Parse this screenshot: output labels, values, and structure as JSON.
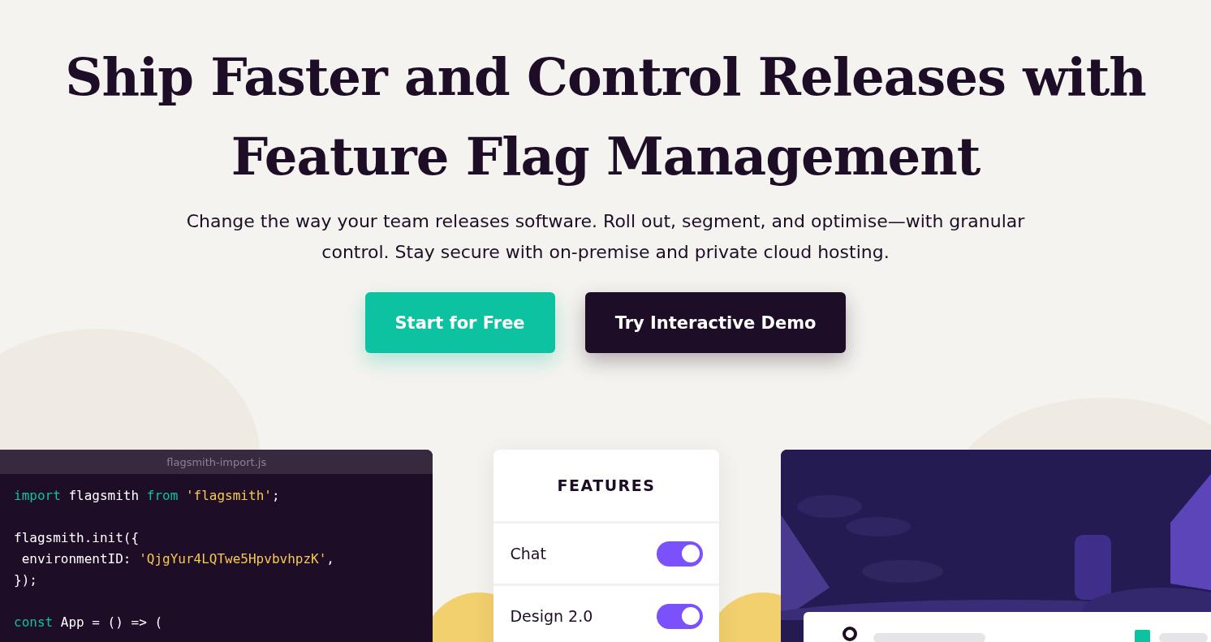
{
  "hero": {
    "title": "Ship Faster and Control Releases with Feature Flag Management",
    "subtitle": "Change the way your team releases software. Roll out, segment, and optimise—with granular control. Stay secure with on-premise and private cloud hosting."
  },
  "buttons": [
    {
      "label": "Start for Free",
      "kind": "primary"
    },
    {
      "label": "Try Interactive Demo",
      "kind": "dark"
    }
  ],
  "code_panel": {
    "filename": "flagsmith-import.js",
    "lines": [
      {
        "kind": "code",
        "tokens": [
          {
            "kind": "keyword",
            "text": "import"
          },
          {
            "kind": "plain",
            "text": " flagsmith "
          },
          {
            "kind": "keyword",
            "text": "from"
          },
          {
            "kind": "string",
            "text": " 'flagsmith'"
          },
          {
            "kind": "plain",
            "text": ";"
          }
        ]
      },
      {
        "kind": "blank"
      },
      {
        "kind": "code",
        "tokens": [
          {
            "kind": "plain",
            "text": "flagsmith.init({"
          }
        ]
      },
      {
        "kind": "code",
        "tokens": [
          {
            "kind": "plain",
            "text": " environmentID: "
          },
          {
            "kind": "string",
            "text": "'QjgYur4LQTwe5HpvbvhpzK'"
          },
          {
            "kind": "plain",
            "text": ","
          }
        ]
      },
      {
        "kind": "code",
        "tokens": [
          {
            "kind": "plain",
            "text": "});"
          }
        ]
      },
      {
        "kind": "blank"
      },
      {
        "kind": "code",
        "tokens": [
          {
            "kind": "keyword",
            "text": "const"
          },
          {
            "kind": "plain",
            "text": " App = () => ("
          }
        ]
      }
    ]
  },
  "features_card": {
    "title": "FEATURES",
    "items": [
      {
        "label": "Chat",
        "on": true
      },
      {
        "label": "Design 2.0",
        "on": true
      }
    ]
  }
}
